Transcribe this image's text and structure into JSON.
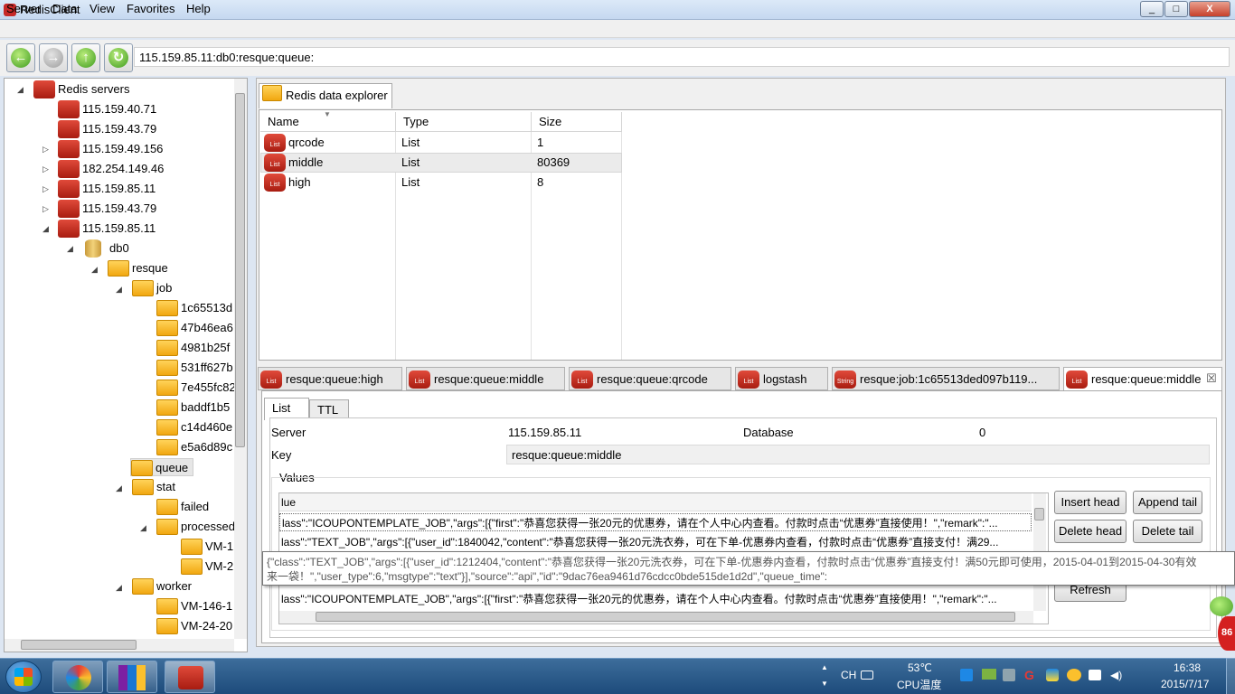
{
  "window": {
    "title": "RedisClient",
    "min": "_",
    "max": "□",
    "close": "X"
  },
  "menu": [
    "Server",
    "Data",
    "View",
    "Favorites",
    "Help"
  ],
  "toolbar": {
    "address": "115.159.85.11:db0:resque:queue:"
  },
  "tree": {
    "root": "Redis servers",
    "servers": [
      "115.159.40.71",
      "115.159.43.79",
      "115.159.49.156",
      "182.254.149.46",
      "115.159.85.11",
      "115.159.43.79",
      "115.159.85.11"
    ],
    "db": "db0",
    "resque": "resque",
    "job": "job",
    "jobs": [
      "1c65513d",
      "47b46ea6",
      "4981b25f",
      "531ff627b",
      "7e455fc82",
      "baddf1b5",
      "c14d460e",
      "e5a6d89c"
    ],
    "queue": "queue",
    "stat": "stat",
    "failed": "failed",
    "processed": "processed",
    "processed_children": [
      "VM-1",
      "VM-2"
    ],
    "worker": "worker",
    "worker_children": [
      "VM-146-1",
      "VM-24-20"
    ]
  },
  "explorer": {
    "tab_label": "Redis data explorer",
    "columns": [
      "Name",
      "Type",
      "Size"
    ],
    "rows": [
      {
        "name": "qrcode",
        "type": "List",
        "size": "1"
      },
      {
        "name": "middle",
        "type": "List",
        "size": "80369"
      },
      {
        "name": "high",
        "type": "List",
        "size": "8"
      }
    ]
  },
  "key_tabs": [
    {
      "label": "resque:queue:high",
      "icon": "List"
    },
    {
      "label": "resque:queue:middle",
      "icon": "List"
    },
    {
      "label": "resque:queue:qrcode",
      "icon": "List"
    },
    {
      "label": "logstash",
      "icon": "List"
    },
    {
      "label": "resque:job:1c65513ded097b119...",
      "icon": "String"
    },
    {
      "label": "resque:queue:middle",
      "icon": "List"
    }
  ],
  "key_tab_close": "☒",
  "detail": {
    "subtabs": [
      "List",
      "TTL"
    ],
    "server_label": "Server",
    "server_value": "115.159.85.11",
    "database_label": "Database",
    "database_value": "0",
    "key_label": "Key",
    "key_value": "resque:queue:middle",
    "values_label": "Values",
    "values_header": "lue",
    "values": [
      "lass\":\"ICOUPONTEMPLATE_JOB\",\"args\":[{\"first\":\"恭喜您获得一张20元的优惠券，请在个人中心内查看。付款时点击“优惠券”直接使用！\",\"remark\":\"...",
      "lass\":\"TEXT_JOB\",\"args\":[{\"user_id\":1840042,\"content\":\"恭喜您获得一张20元洗衣券，可在下单-优惠券内查看，付款时点击“优惠券”直接支付！满29...",
      "",
      "lass\":\"ICOUPONTEMPLATE_JOB\",\"args\":[{\"first\":\"恭喜您获得一张20元的优惠券，请在个人中心内查看。付款时点击“优惠券”直接使用！\",\"remark\":\"..."
    ],
    "buttons": {
      "insert_head": "Insert head",
      "append_tail": "Append tail",
      "delete_head": "Delete head",
      "delete_tail": "Delete tail",
      "refresh": "Refresh"
    },
    "tooltip_line1": "{\"class\":\"TEXT_JOB\",\"args\":[{\"user_id\":1212404,\"content\":\"恭喜您获得一张20元洗衣券，可在下单-优惠券内查看，付款时点击“优惠券”直接支付！满50元即可使用，2015-04-01到2015-04-30有效",
    "tooltip_line2": "来一袋！\",\"user_type\":6,\"msgtype\":\"text\"}],\"source\":\"api\",\"id\":\"9dac76ea9461d76cdcc0bde515de1d2d\",\"queue_time\":"
  },
  "taskbar": {
    "lang": "CH",
    "temp": "53℃",
    "temp_label": "CPU温度",
    "time": "16:38",
    "date": "2015/7/17",
    "badge": "86"
  }
}
